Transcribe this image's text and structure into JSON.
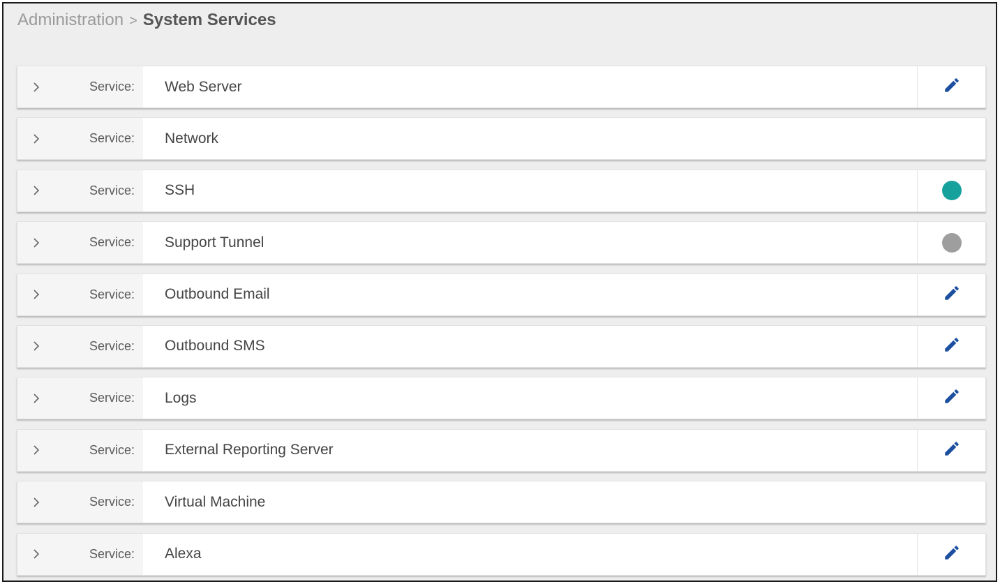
{
  "breadcrumb": {
    "parent": "Administration",
    "separator": ">",
    "current": "System Services"
  },
  "colors": {
    "status_on": "#17a19c",
    "status_off": "#9e9e9e",
    "edit_icon": "#1c4fa0"
  },
  "services": [
    {
      "prefix": "Service:",
      "name": "Web Server",
      "action": "edit"
    },
    {
      "prefix": "Service:",
      "name": "Network",
      "action": "none"
    },
    {
      "prefix": "Service:",
      "name": "SSH",
      "action": "status-on"
    },
    {
      "prefix": "Service:",
      "name": "Support Tunnel",
      "action": "status-off"
    },
    {
      "prefix": "Service:",
      "name": "Outbound Email",
      "action": "edit"
    },
    {
      "prefix": "Service:",
      "name": "Outbound SMS",
      "action": "edit"
    },
    {
      "prefix": "Service:",
      "name": "Logs",
      "action": "edit"
    },
    {
      "prefix": "Service:",
      "name": "External Reporting Server",
      "action": "edit"
    },
    {
      "prefix": "Service:",
      "name": "Virtual Machine",
      "action": "none"
    },
    {
      "prefix": "Service:",
      "name": "Alexa",
      "action": "edit"
    }
  ]
}
